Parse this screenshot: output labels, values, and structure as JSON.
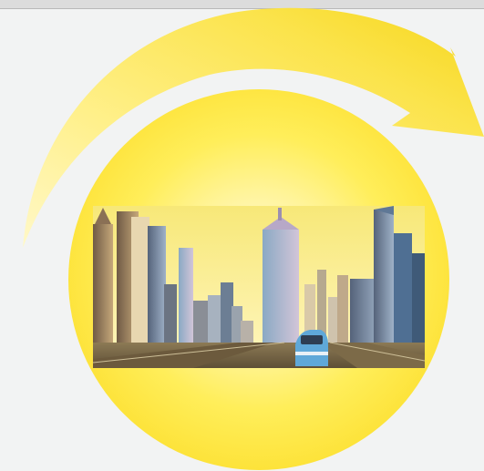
{
  "colors": {
    "background": "#f2f3f3",
    "top_rule": "#dcdcdc",
    "arrow_light": "#fff49a",
    "arrow_dark": "#f8d81c",
    "circle_center": "#fffbe0",
    "circle_edge": "#fbdc2c",
    "sky_top": "#f6e97a",
    "sky_bottom": "#fff8c4",
    "track": "#7a6a48",
    "train": "#5fa8d8"
  },
  "icons": {
    "arrow": "curved-arrow-icon",
    "circle": "sun-circle",
    "photo": "dubai-skyline-photo"
  }
}
